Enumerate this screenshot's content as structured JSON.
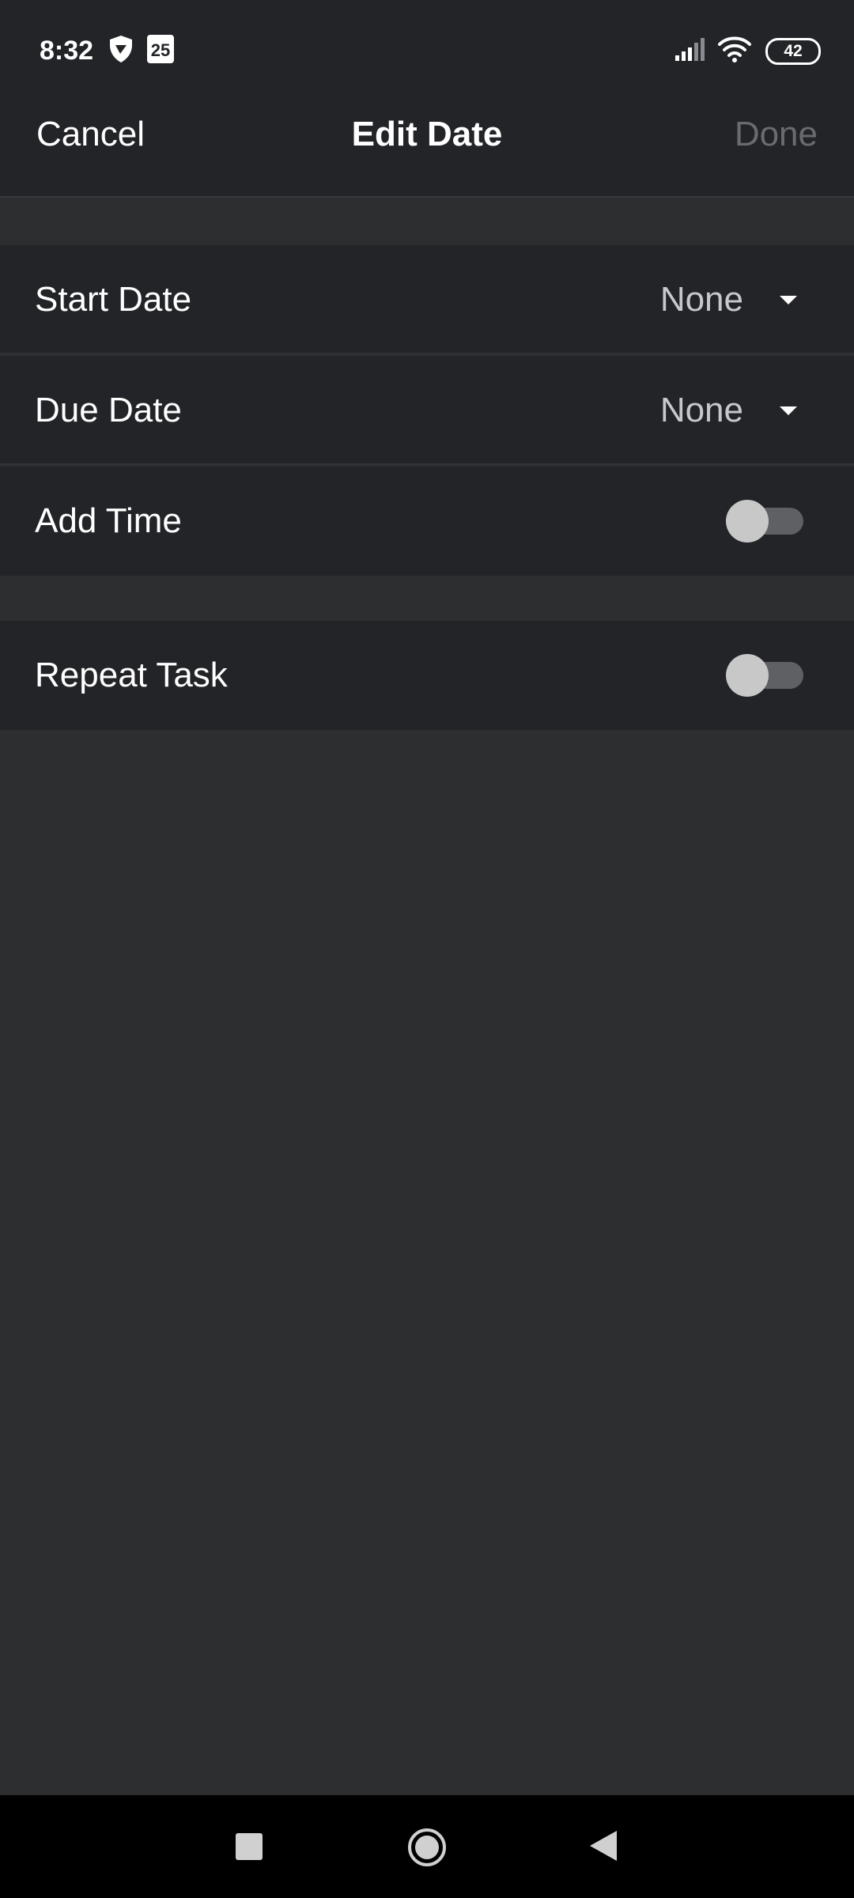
{
  "status_bar": {
    "time": "8:32",
    "calendar_day": "25",
    "battery": "42",
    "icons": [
      "shield-app-icon",
      "calendar-icon",
      "signal-icon",
      "wifi-icon",
      "battery-icon"
    ]
  },
  "header": {
    "cancel_label": "Cancel",
    "title": "Edit Date",
    "done_label": "Done"
  },
  "rows": {
    "start_date": {
      "label": "Start Date",
      "value": "None"
    },
    "due_date": {
      "label": "Due Date",
      "value": "None"
    },
    "add_time": {
      "label": "Add Time",
      "enabled": false
    },
    "repeat_task": {
      "label": "Repeat Task",
      "enabled": false
    }
  },
  "system_nav": {
    "buttons": [
      "recents-icon",
      "home-icon",
      "back-icon"
    ]
  },
  "colors": {
    "background": "#2d2e30",
    "surface": "#232428",
    "text": "#ffffff",
    "muted_text": "#c7c8cb",
    "disabled_text": "#6a6b6f",
    "toggle_track_off": "#5f6064",
    "toggle_thumb_off": "#c8c8c8"
  }
}
